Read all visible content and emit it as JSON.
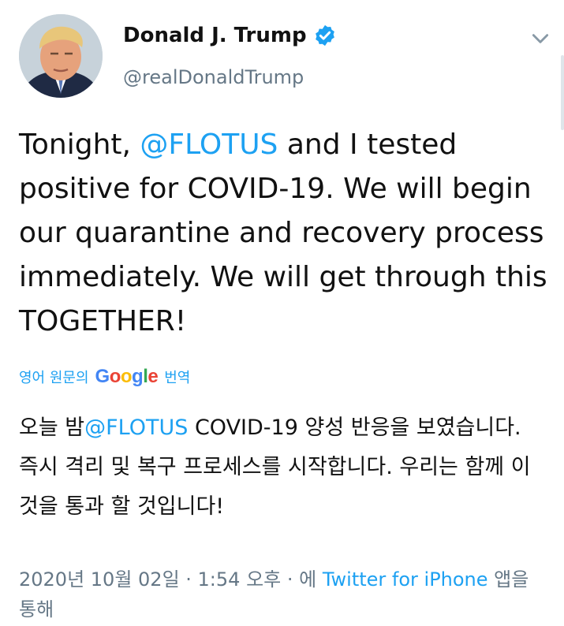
{
  "author": {
    "name": "Donald J. Trump",
    "handle": "@realDonaldTrump",
    "verified_icon": "verified-badge-icon",
    "menu_icon": "chevron-down-icon"
  },
  "tweet": {
    "text_part1": "Tonight, ",
    "mention": "@FLOTUS",
    "text_part2": " and I tested positive for COVID-19. We will begin our quarantine and recovery process immediately. We will get through this TOGETHER!"
  },
  "translation": {
    "prefix": "영어 원문의",
    "google": "Google",
    "suffix": "번역",
    "text_part1": "오늘 밤",
    "mention": "@FLOTUS",
    "text_part2": " COVID-19 양성 반응을 보였습니다. 즉시 격리 및 복구 프로세스를 시작합니다. 우리는 함께 이것을 통과 할 것입니다!"
  },
  "meta": {
    "timestamp": "2020년 10월 02일 · 1:54 오후 · 에 ",
    "source": "Twitter for iPhone",
    "suffix": " 앱을 통해"
  },
  "colors": {
    "accent": "#1da1f2",
    "secondary_text": "#657786"
  }
}
